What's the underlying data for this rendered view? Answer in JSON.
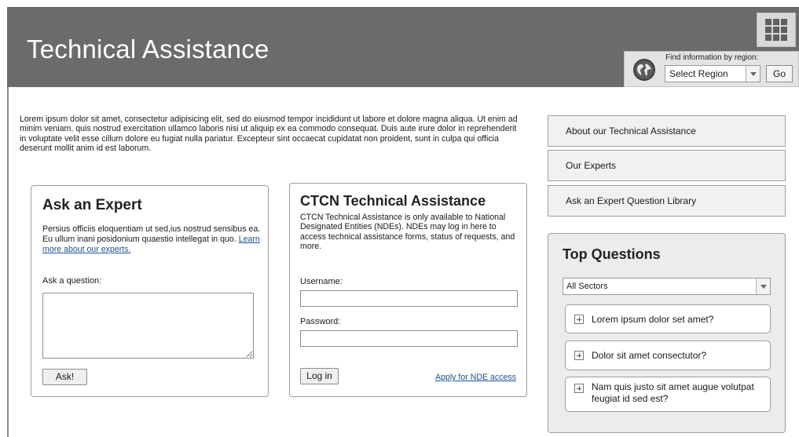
{
  "header": {
    "title": "Technical Assistance",
    "region_label": "Find information by region:",
    "region_select_value": "Select Region",
    "go_label": "Go"
  },
  "intro": {
    "text": "Lorem ipsum dolor sit amet, consectetur adipisicing elit, sed do eiusmod tempor incididunt ut labore et dolore magna aliqua. Ut enim ad minim veniam, quis nostrud exercitation ullamco laboris nisi ut aliquip ex ea commodo consequat. Duis aute irure dolor in reprehenderit in voluptate velit esse cillum dolore eu fugiat nulla pariatur. Excepteur sint occaecat cupidatat non proident, sunt in culpa qui officia deserunt mollit anim id est laborum."
  },
  "ask_expert": {
    "title": "Ask an Expert",
    "description": "Persius officiis eloquentiam ut sed,ius nostrud sensibus ea. Eu ullum inani posidonium quaestio intellegat in quo.",
    "link": "Learn more about our experts.",
    "question_label": "Ask a question:",
    "question_value": "",
    "ask_button": "Ask!"
  },
  "ctcn": {
    "title": "CTCN Technical Assistance",
    "description": "CTCN Technical Assistance is only available to National Designated Entities (NDEs). NDEs may log in here to access technical assistance forms, status of requests, and more.",
    "username_label": "Username:",
    "username_value": "",
    "password_label": "Password:",
    "password_value": "",
    "login_button": "Log in",
    "apply_link": "Apply for NDE access"
  },
  "nav": {
    "items": [
      "About our Technical Assistance",
      "Our Experts",
      "Ask an Expert Question Library"
    ]
  },
  "top_questions": {
    "title": "Top Questions",
    "sector_value": "All Sectors",
    "items": [
      "Lorem ipsum dolor set amet?",
      "Dolor sit amet consectutor?",
      "Nam quis justo sit amet augue volutpat feugiat id sed est?"
    ]
  },
  "icons": [
    "grid-icon",
    "globe-icon",
    "chevron-down-icon",
    "plus-icon"
  ],
  "colors": {
    "header_bg": "#6b6b6b",
    "link": "#1e4f9a",
    "panel_bg": "#ececec"
  }
}
